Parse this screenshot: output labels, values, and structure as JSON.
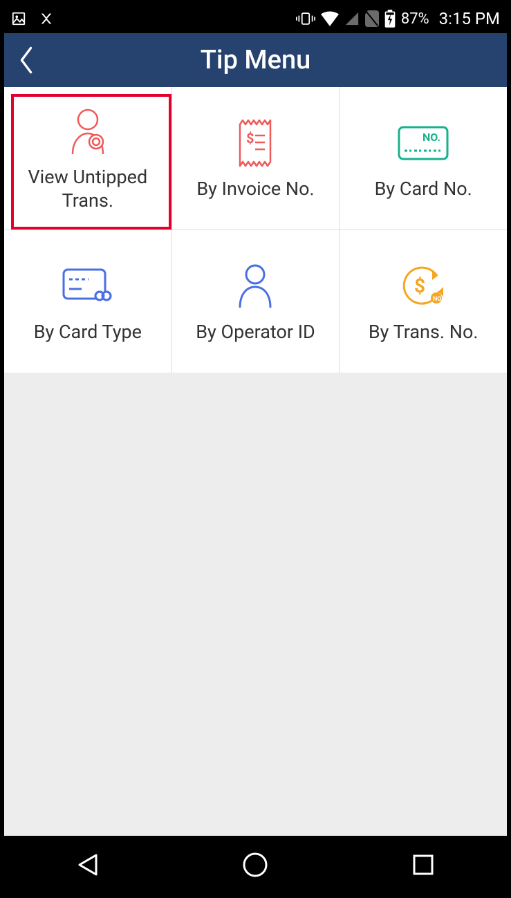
{
  "status": {
    "battery_pct": "87%",
    "time": "3:15 PM"
  },
  "header": {
    "title": "Tip Menu"
  },
  "tiles": [
    {
      "label": "View Untipped Trans.",
      "icon": "user-search",
      "color": "#ef5a5a",
      "selected": true
    },
    {
      "label": "By Invoice No.",
      "icon": "receipt",
      "color": "#ef5a5a",
      "selected": false
    },
    {
      "label": "By Card No.",
      "icon": "card-no",
      "color": "#17b18c",
      "selected": false
    },
    {
      "label": "By Card Type",
      "icon": "card-type",
      "color": "#4a6fe3",
      "selected": false
    },
    {
      "label": "By Operator ID",
      "icon": "user",
      "color": "#4a6fe3",
      "selected": false
    },
    {
      "label": "By Trans. No.",
      "icon": "trans-no",
      "color": "#f5a623",
      "selected": false
    }
  ]
}
